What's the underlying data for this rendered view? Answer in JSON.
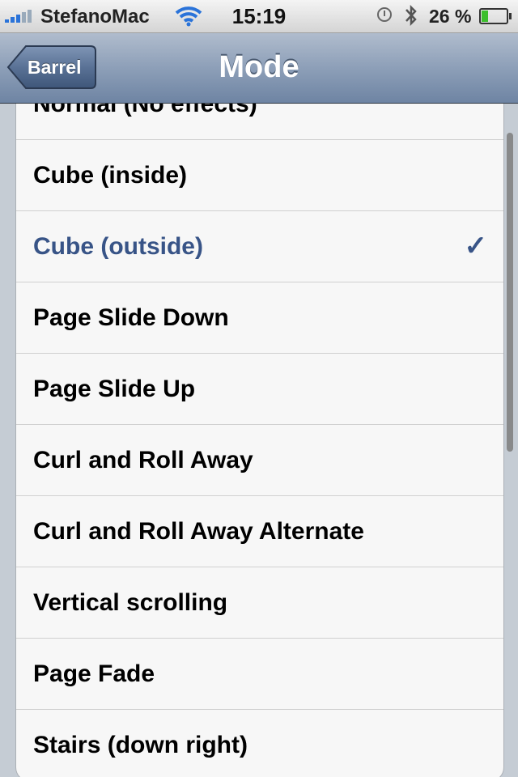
{
  "status_bar": {
    "carrier": "StefanoMac",
    "time": "15:19",
    "battery_percent": "26 %",
    "battery_level": 0.26,
    "icons": [
      "signal-icon",
      "wifi-icon",
      "alarm-icon",
      "bluetooth-icon",
      "battery-icon"
    ]
  },
  "nav": {
    "back_label": "Barrel",
    "title": "Mode"
  },
  "list": {
    "items": [
      {
        "label": "Normal (No effects)",
        "selected": false
      },
      {
        "label": "Cube (inside)",
        "selected": false
      },
      {
        "label": "Cube (outside)",
        "selected": true
      },
      {
        "label": "Page Slide Down",
        "selected": false
      },
      {
        "label": "Page Slide Up",
        "selected": false
      },
      {
        "label": "Curl and Roll Away",
        "selected": false
      },
      {
        "label": "Curl and Roll Away Alternate",
        "selected": false
      },
      {
        "label": "Vertical scrolling",
        "selected": false
      },
      {
        "label": "Page Fade",
        "selected": false
      },
      {
        "label": "Stairs (down right)",
        "selected": false
      }
    ],
    "checkmark": "✓"
  },
  "colors": {
    "selected_text": "#385487",
    "nav_bar": "#8d9fb8",
    "background": "#c5ccd4",
    "signal": "#2a73d9",
    "battery_fill": "#3cbf2d"
  }
}
